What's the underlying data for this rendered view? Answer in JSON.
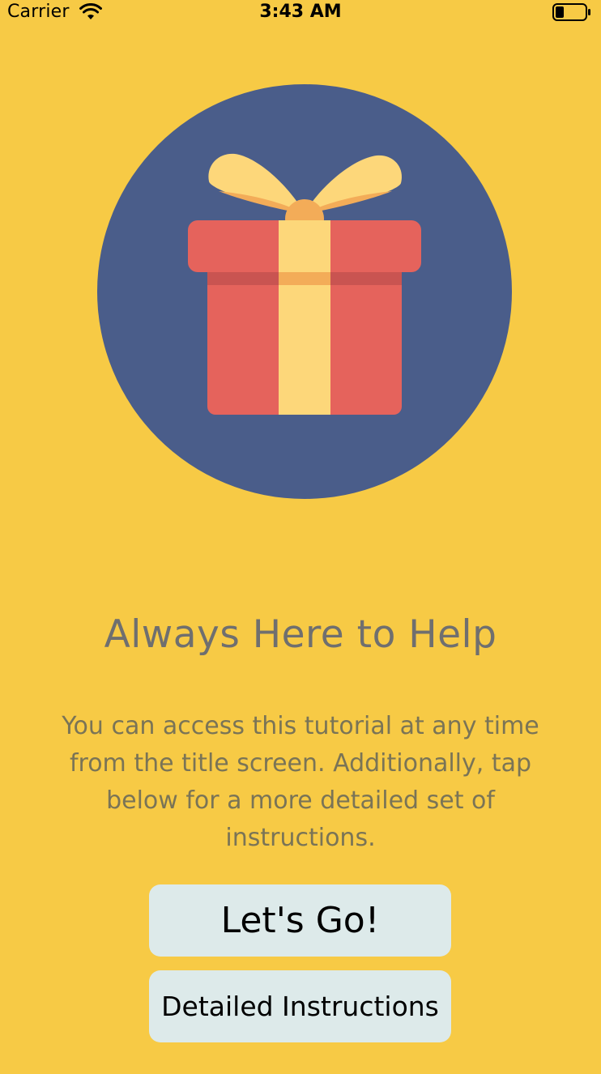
{
  "status_bar": {
    "carrier": "Carrier",
    "time": "3:43 AM",
    "wifi_icon": "wifi-icon",
    "battery_icon": "battery-low-icon"
  },
  "hero": {
    "icon": "gift-box-icon",
    "colors": {
      "circle": "#4A5D8A",
      "box": "#E5635C",
      "box_shadow": "#C95451",
      "ribbon": "#FDD77A",
      "ribbon_shadow": "#F3AC58"
    }
  },
  "content": {
    "title": "Always Here to Help",
    "description": "You can access this tutorial at any time from the title screen. Additionally, tap below for a more detailed set of instructions."
  },
  "buttons": {
    "primary_label": "Let's Go!",
    "secondary_label": "Detailed Instructions"
  },
  "colors": {
    "background": "#F7CA45",
    "button_bg": "#DDEAEA",
    "title_text": "#6F6F6F"
  }
}
